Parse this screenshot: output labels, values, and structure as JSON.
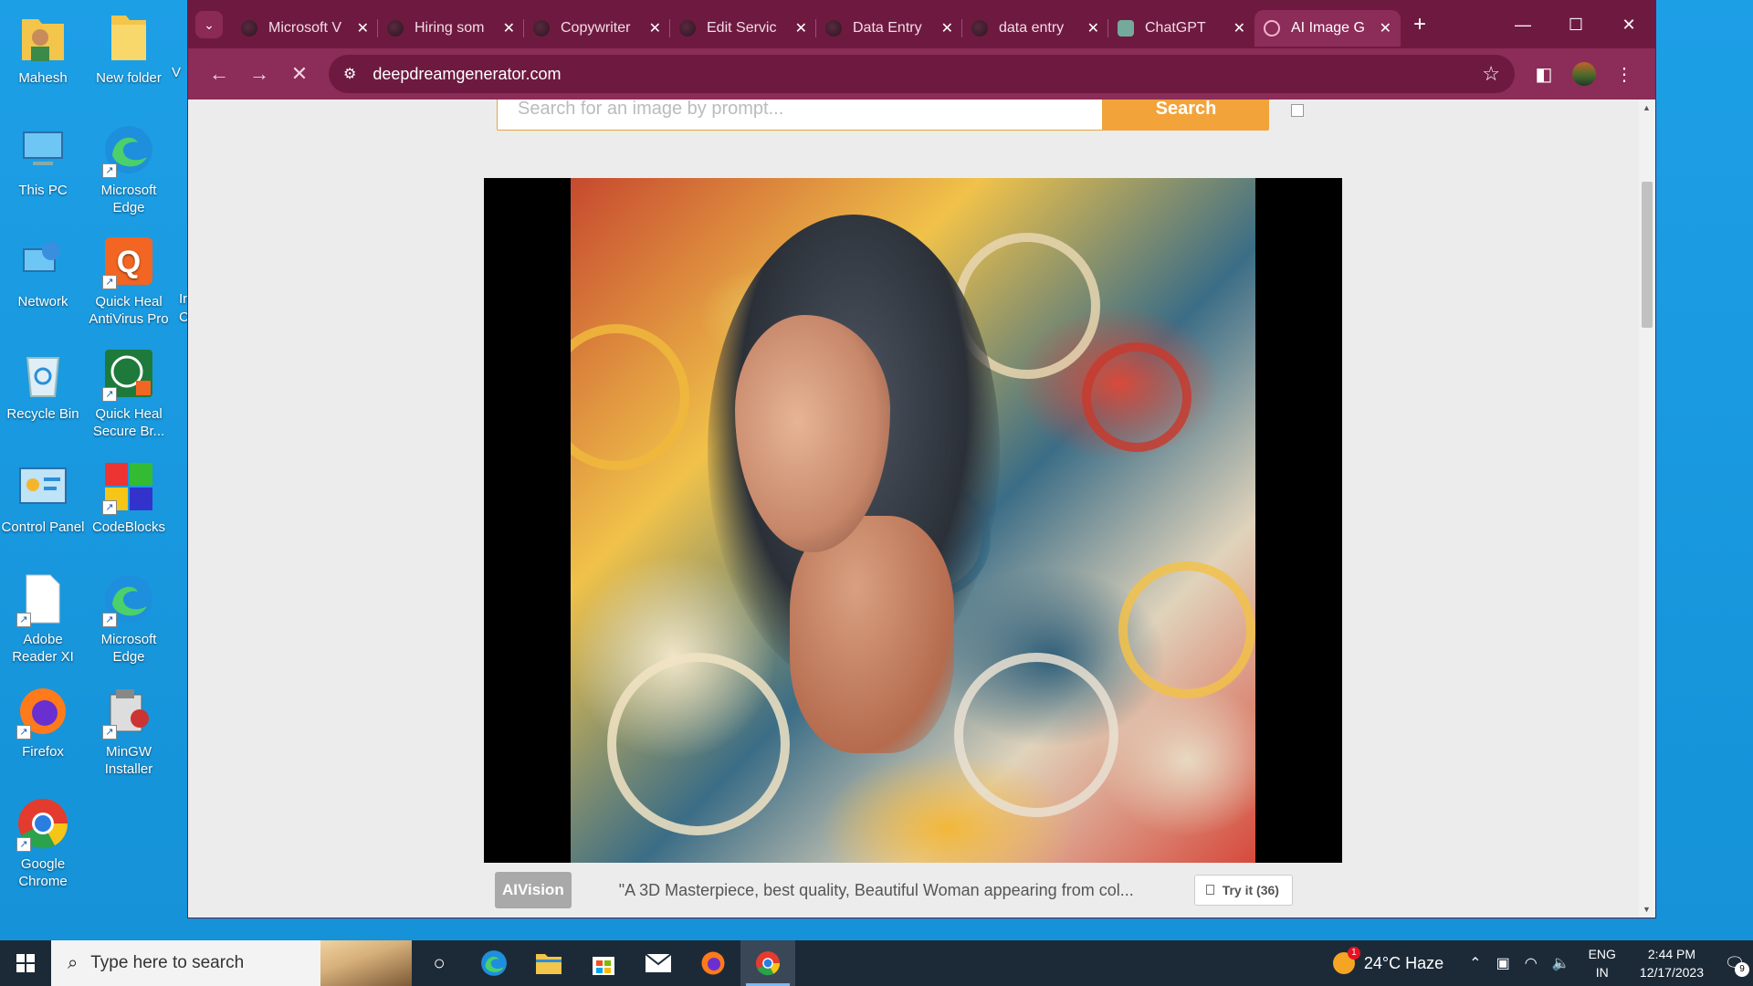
{
  "desktop": {
    "icons": [
      {
        "label": "Mahesh",
        "icon": "user-folder-icon"
      },
      {
        "label": "New folder",
        "icon": "folder-icon"
      },
      {
        "label": "This PC",
        "icon": "computer-icon"
      },
      {
        "label": "Microsoft Edge",
        "icon": "edge-icon"
      },
      {
        "label": "Network",
        "icon": "network-icon"
      },
      {
        "label": "Quick Heal AntiVirus Pro",
        "icon": "quickheal-icon"
      },
      {
        "label": "Recycle Bin",
        "icon": "recycle-bin-icon"
      },
      {
        "label": "Quick Heal Secure Br...",
        "icon": "quickheal-browser-icon"
      },
      {
        "label": "Control Panel",
        "icon": "control-panel-icon"
      },
      {
        "label": "CodeBlocks",
        "icon": "codeblocks-icon"
      },
      {
        "label": "Adobe Reader XI",
        "icon": "document-icon"
      },
      {
        "label": "Microsoft Edge",
        "icon": "edge-icon"
      },
      {
        "label": "Firefox",
        "icon": "firefox-icon"
      },
      {
        "label": "MinGW Installer",
        "icon": "installer-icon"
      },
      {
        "label": "Google Chrome",
        "icon": "chrome-icon"
      }
    ],
    "partial_labels": [
      "V",
      "Ir",
      "C"
    ]
  },
  "browser": {
    "tabs": [
      {
        "title": "Microsoft V"
      },
      {
        "title": "Hiring som"
      },
      {
        "title": "Copywriter"
      },
      {
        "title": "Edit Servic"
      },
      {
        "title": "Data Entry"
      },
      {
        "title": "data entry"
      },
      {
        "title": "ChatGPT"
      },
      {
        "title": "AI Image G"
      }
    ],
    "active_tab_index": 7,
    "url": "deepdreamgenerator.com",
    "accent": "#8c2c58",
    "tabstrip_color": "#6e1a40"
  },
  "page": {
    "search_placeholder": "Search for an image by prompt...",
    "search_button": "Search",
    "badge": "AIVision",
    "caption": "\"A 3D Masterpiece, best quality, Beautiful Woman appearing from col...",
    "try_button": "Try it (36)"
  },
  "taskbar": {
    "search_placeholder": "Type here to search",
    "weather": "24°C  Haze",
    "weather_badge": "1",
    "lang_line1": "ENG",
    "lang_line2": "IN",
    "time": "2:44 PM",
    "date": "12/17/2023",
    "notification_count": "9"
  }
}
